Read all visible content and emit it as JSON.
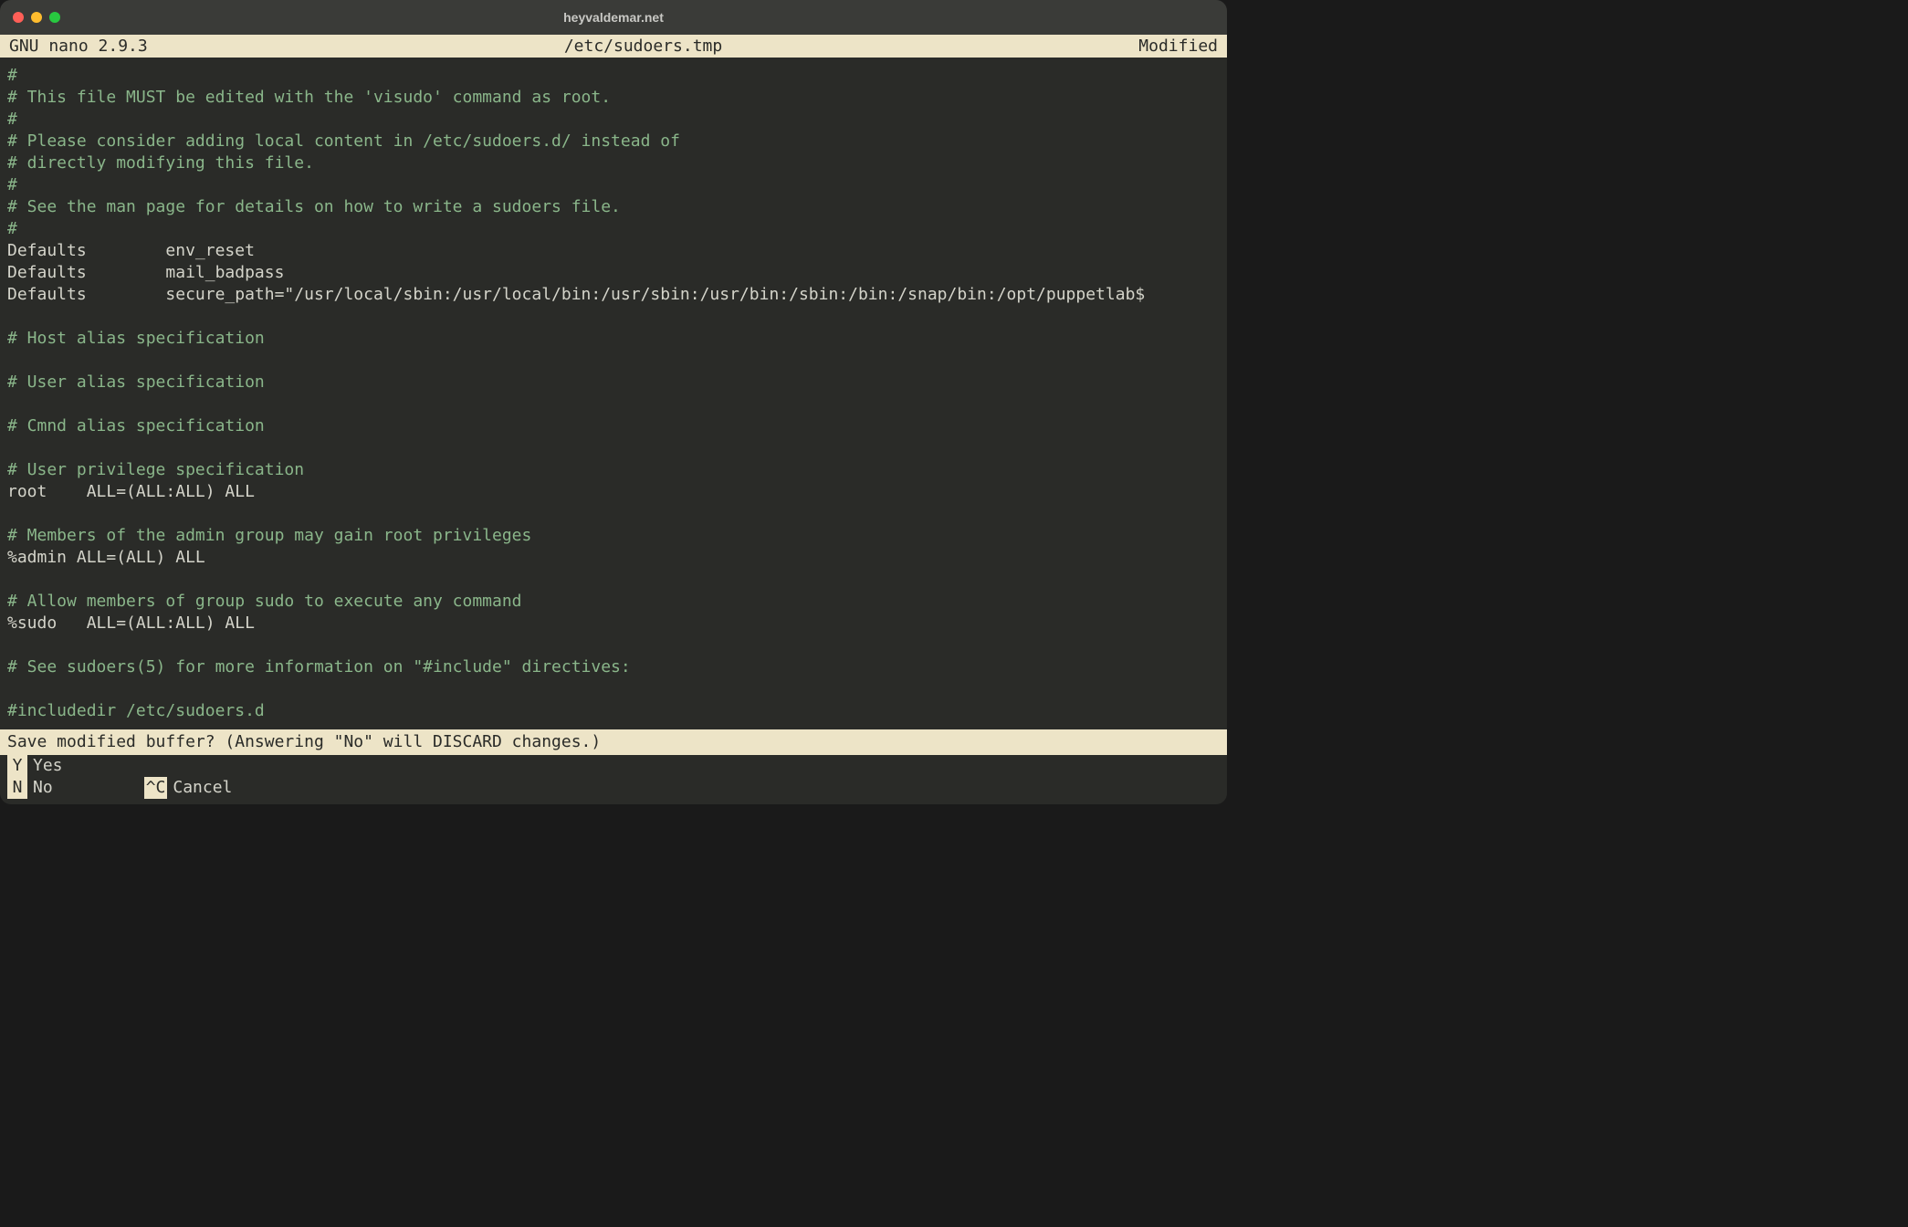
{
  "window": {
    "title": "heyvaldemar.net"
  },
  "editor": {
    "app": "GNU nano 2.9.3",
    "file": "/etc/sudoers.tmp",
    "status": "Modified"
  },
  "lines": [
    {
      "type": "comment",
      "text": "#"
    },
    {
      "type": "comment",
      "text": "# This file MUST be edited with the 'visudo' command as root."
    },
    {
      "type": "comment",
      "text": "#"
    },
    {
      "type": "comment",
      "text": "# Please consider adding local content in /etc/sudoers.d/ instead of"
    },
    {
      "type": "comment",
      "text": "# directly modifying this file."
    },
    {
      "type": "comment",
      "text": "#"
    },
    {
      "type": "comment",
      "text": "# See the man page for details on how to write a sudoers file."
    },
    {
      "type": "comment",
      "text": "#"
    },
    {
      "type": "normal",
      "text": "Defaults        env_reset"
    },
    {
      "type": "normal",
      "text": "Defaults        mail_badpass"
    },
    {
      "type": "normal",
      "text": "Defaults        secure_path=\"/usr/local/sbin:/usr/local/bin:/usr/sbin:/usr/bin:/sbin:/bin:/snap/bin:/opt/puppetlab$"
    },
    {
      "type": "normal",
      "text": ""
    },
    {
      "type": "comment",
      "text": "# Host alias specification"
    },
    {
      "type": "normal",
      "text": ""
    },
    {
      "type": "comment",
      "text": "# User alias specification"
    },
    {
      "type": "normal",
      "text": ""
    },
    {
      "type": "comment",
      "text": "# Cmnd alias specification"
    },
    {
      "type": "normal",
      "text": ""
    },
    {
      "type": "comment",
      "text": "# User privilege specification"
    },
    {
      "type": "normal",
      "text": "root    ALL=(ALL:ALL) ALL"
    },
    {
      "type": "normal",
      "text": ""
    },
    {
      "type": "comment",
      "text": "# Members of the admin group may gain root privileges"
    },
    {
      "type": "normal",
      "text": "%admin ALL=(ALL) ALL"
    },
    {
      "type": "normal",
      "text": ""
    },
    {
      "type": "comment",
      "text": "# Allow members of group sudo to execute any command"
    },
    {
      "type": "normal",
      "text": "%sudo   ALL=(ALL:ALL) ALL"
    },
    {
      "type": "normal",
      "text": ""
    },
    {
      "type": "comment",
      "text": "# See sudoers(5) for more information on \"#include\" directives:"
    },
    {
      "type": "normal",
      "text": ""
    },
    {
      "type": "comment",
      "text": "#includedir /etc/sudoers.d"
    }
  ],
  "prompt": {
    "question": "Save modified buffer?  (Answering \"No\" will DISCARD changes.)"
  },
  "shortcuts": {
    "yes_key": " Y",
    "yes_label": "Yes",
    "no_key": " N",
    "no_label": "No",
    "cancel_key": "^C",
    "cancel_label": "Cancel"
  }
}
